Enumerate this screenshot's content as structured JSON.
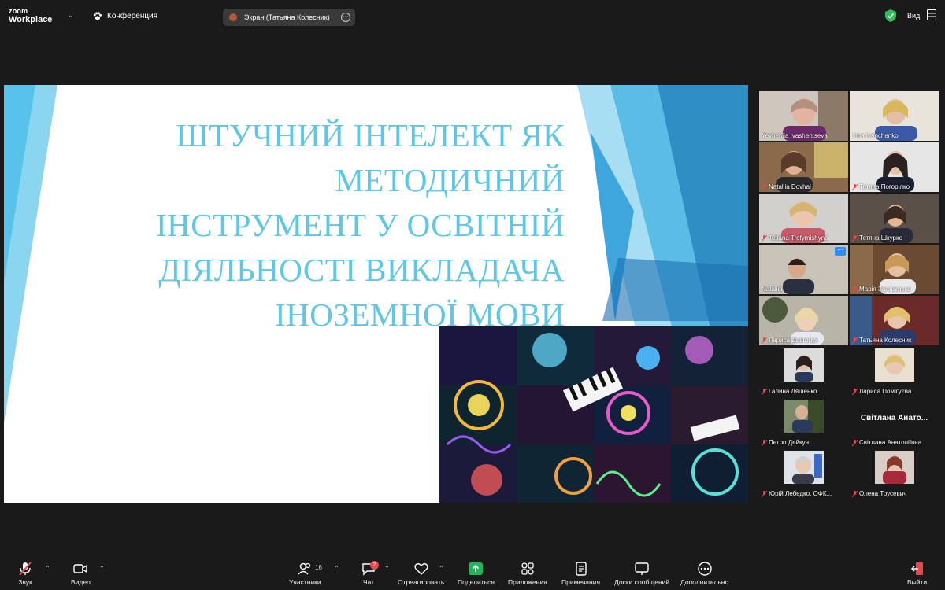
{
  "app": {
    "logo_line1": "zoom",
    "logo_line2": "Workplace"
  },
  "header": {
    "conference_label": "Конференция",
    "screen_share_label": "Экран (Татьяна Колесник)",
    "view_label": "Вид"
  },
  "slide": {
    "title_lines": [
      "ШТУЧНИЙ ІНТЕЛЕКТ ЯК",
      "МЕТОДИЧНИЙ",
      "ІНСТРУМЕНТ У ОСВІТНІЙ",
      "ДІЯЛЬНОСТІ ВИКЛАДАЧА",
      "ІНОЗЕМНОЇ МОВИ"
    ]
  },
  "participants": [
    {
      "name": "Yevheniia Ivashentseva",
      "muted": false
    },
    {
      "name": "Irina Ivanchenko",
      "muted": false
    },
    {
      "name": "Nataliia Dovhal",
      "muted": true
    },
    {
      "name": "Тетяна Погорілко",
      "muted": true
    },
    {
      "name": "Tetiana Trofymishyna",
      "muted": true
    },
    {
      "name": "Тетяна Шкурко",
      "muted": true
    },
    {
      "name": "Nataliia",
      "muted": false
    },
    {
      "name": "Марія Загорулько",
      "muted": true
    },
    {
      "name": "Лариса Довгорук",
      "muted": true
    },
    {
      "name": "Татьяна Колесник",
      "muted": true
    },
    {
      "name": "Галина Ляшенко",
      "muted": true
    },
    {
      "name": "Лариса Помігуєва",
      "muted": true
    },
    {
      "name": "Петро Дейкун",
      "muted": true
    },
    {
      "name": "Світлана Анатоліївна",
      "muted": true,
      "big_name": "Світлана Анато..."
    },
    {
      "name": "Юрій Лебедко, ОФК...",
      "muted": true
    },
    {
      "name": "Олена Трусевич",
      "muted": true
    }
  ],
  "toolbar": {
    "audio_label": "Звук",
    "video_label": "Видео",
    "participants_label": "Участники",
    "participants_count": "16",
    "chat_label": "Чат",
    "chat_badge": "2",
    "react_label": "Отреагировать",
    "share_label": "Поделиться",
    "apps_label": "Приложения",
    "notes_label": "Примечания",
    "whiteboard_label": "Доски сообщений",
    "more_label": "Дополнительно",
    "leave_label": "Выйти"
  },
  "colors": {
    "accent_green": "#3cc36a",
    "share_green": "#1db954",
    "leave_red": "#e5484d",
    "title_blue": "#5ec6e6"
  }
}
